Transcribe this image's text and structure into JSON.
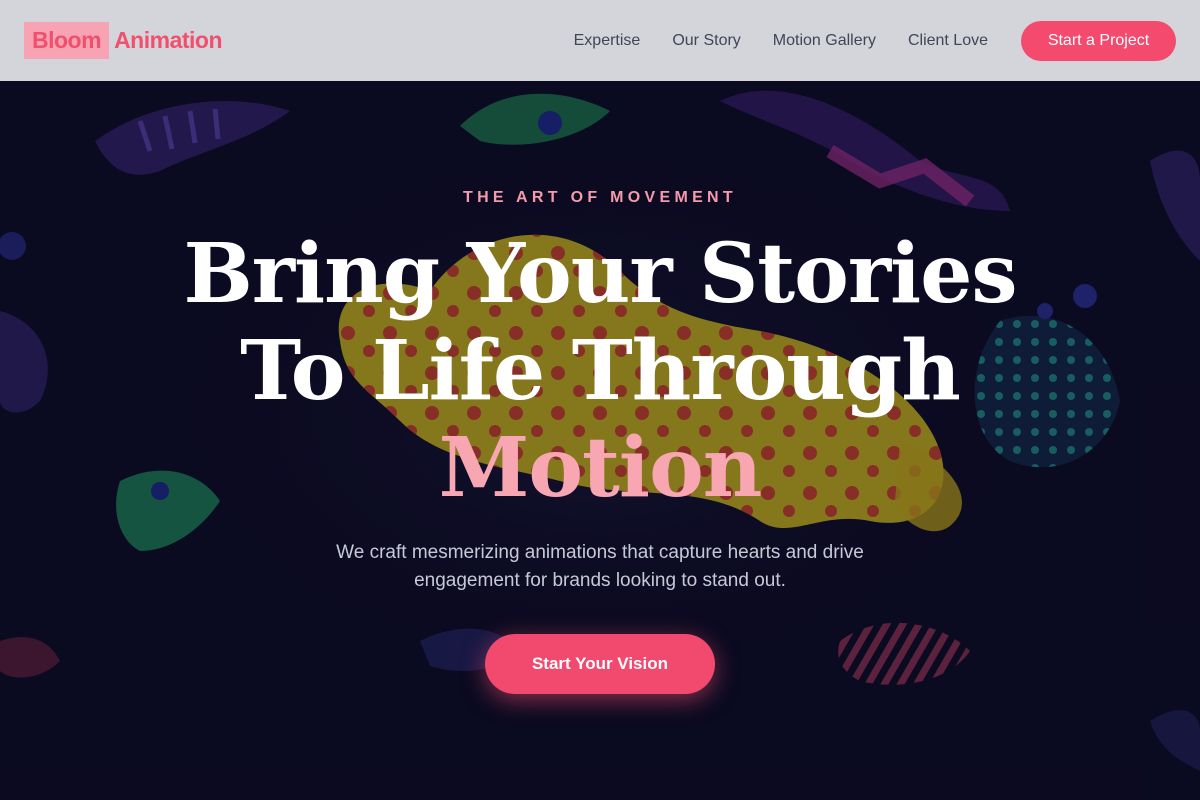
{
  "header": {
    "logo_mark": "Bloom",
    "logo_text": "Animation",
    "nav": [
      "Expertise",
      "Our Story",
      "Motion Gallery",
      "Client Love"
    ],
    "cta_label": "Start a Project"
  },
  "hero": {
    "eyebrow": "THE ART OF MOVEMENT",
    "headline_line1": "Bring Your Stories",
    "headline_line2": "To Life Through",
    "headline_accent": "Motion",
    "subtext": "We craft mesmerizing animations that capture hearts and drive engagement for brands looking to stand out.",
    "cta_label": "Start Your Vision"
  },
  "colors": {
    "brand_pink": "#f0506e",
    "accent_pink": "#f7a6b2",
    "nav_bg": "#d4d5da",
    "hero_bg": "#0b0a1f"
  }
}
